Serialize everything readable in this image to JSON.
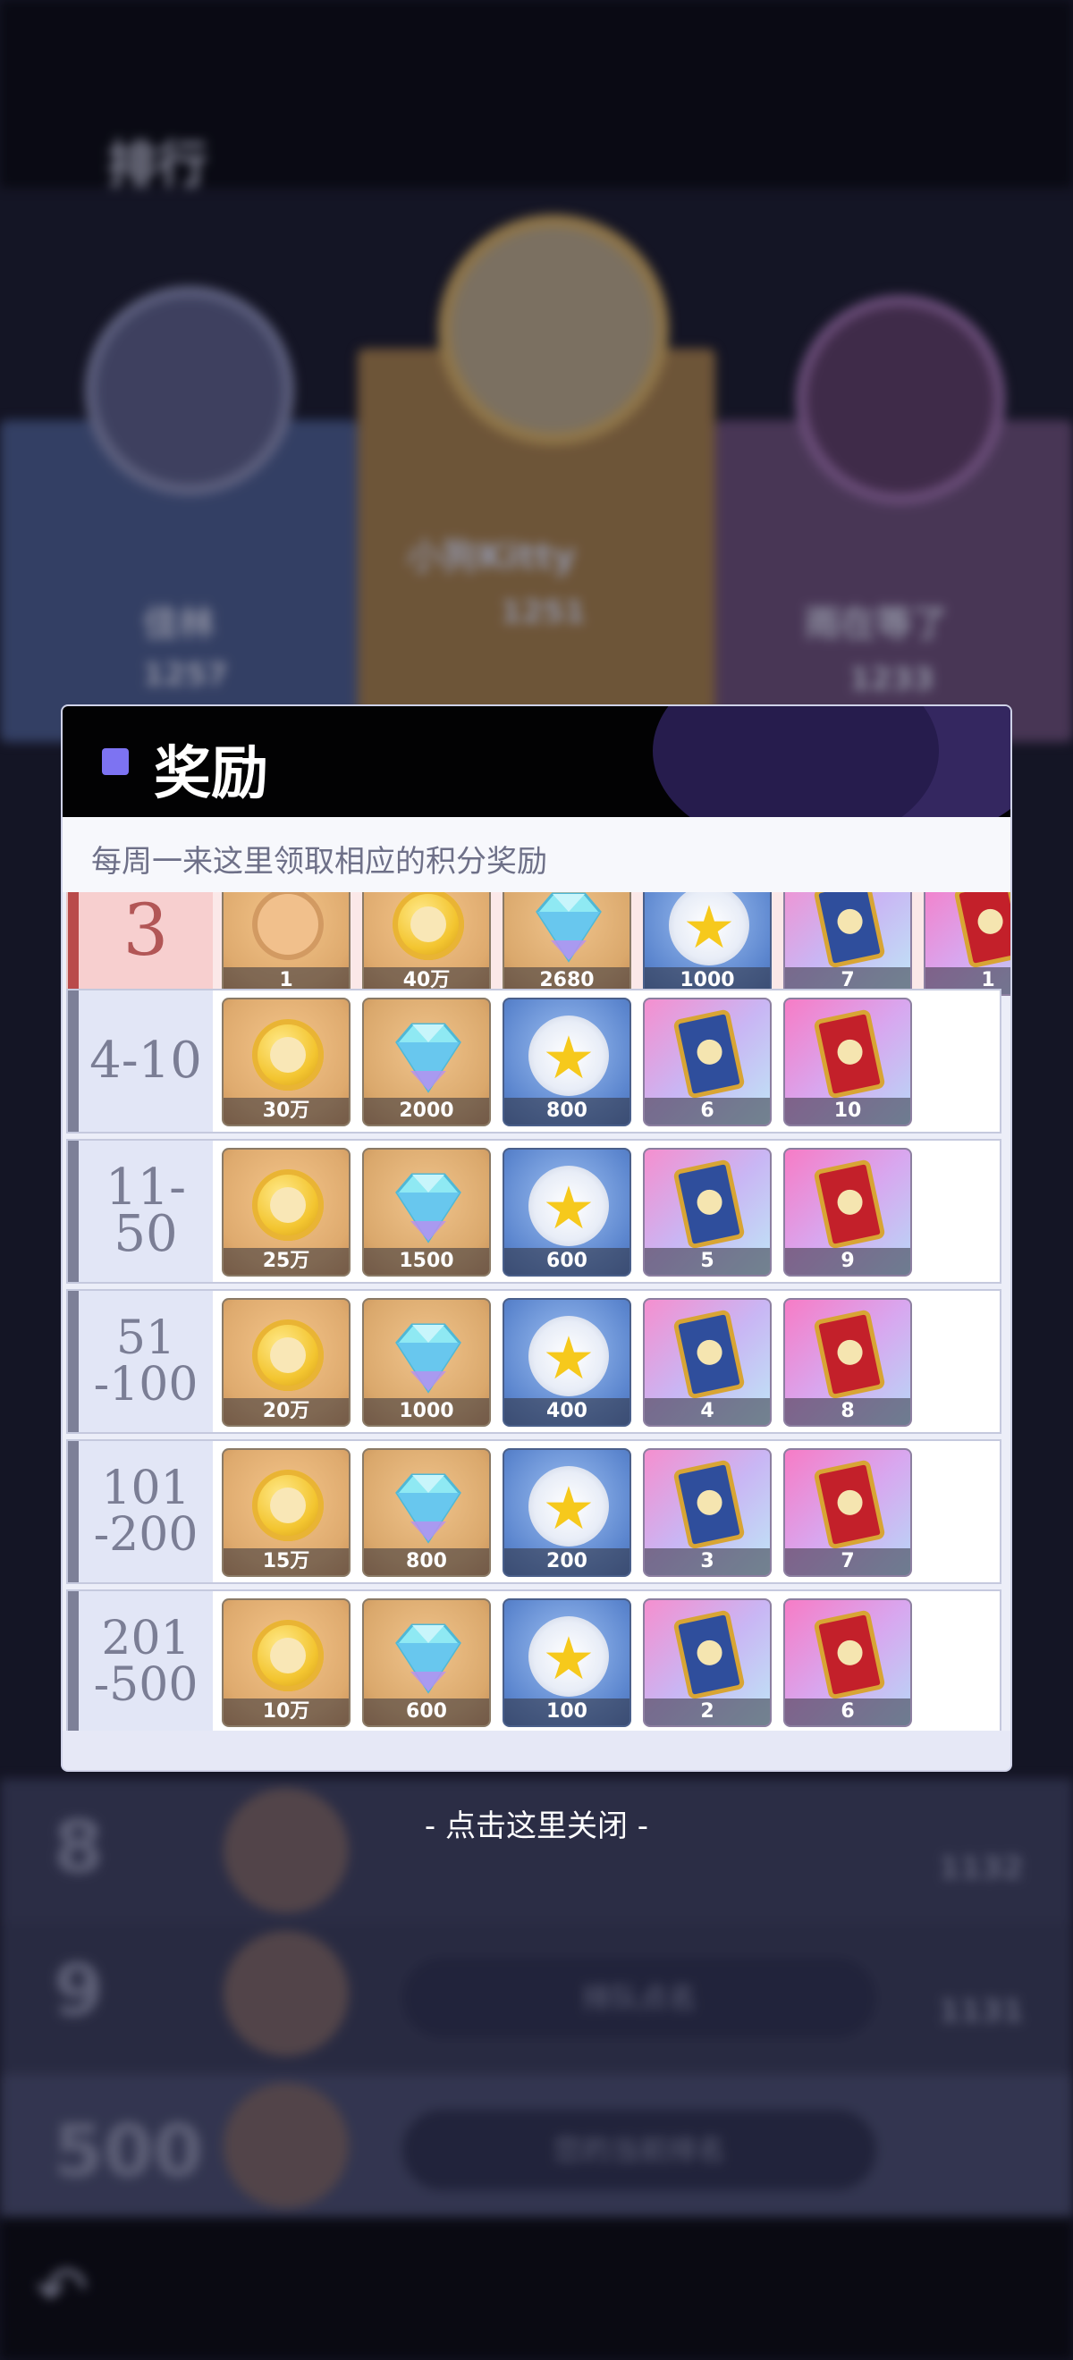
{
  "background": {
    "page_title": "排行",
    "top3": [
      {
        "name": "佳林",
        "score": "1257"
      },
      {
        "name": "小狗Kitty",
        "score": "1251"
      },
      {
        "name": "雨在等了",
        "score": "1233"
      }
    ],
    "rows": [
      {
        "rank": "8",
        "score": "1132"
      },
      {
        "rank": "9",
        "score": "1131",
        "label": "排队点名"
      },
      {
        "rank": "500",
        "label": "您的当前排名"
      }
    ]
  },
  "modal": {
    "title": "奖励",
    "subtitle": "每周一来这里领取相应的积分奖励",
    "close_hint": "- 点击这里关闭 -",
    "tiers": [
      {
        "rank": "3",
        "rewards": [
          {
            "icon": "scroll-icon",
            "qty": "1"
          },
          {
            "icon": "gold-coin-icon",
            "qty": "40万"
          },
          {
            "icon": "diamond-icon",
            "qty": "2680"
          },
          {
            "icon": "star-medal-icon",
            "qty": "1000"
          },
          {
            "icon": "blue-card-icon",
            "qty": "7"
          },
          {
            "icon": "red-card-icon",
            "qty": "1"
          }
        ]
      },
      {
        "rank": "4-10",
        "rewards": [
          {
            "icon": "gold-coin-icon",
            "qty": "30万"
          },
          {
            "icon": "diamond-icon",
            "qty": "2000"
          },
          {
            "icon": "star-medal-icon",
            "qty": "800"
          },
          {
            "icon": "blue-card-icon",
            "qty": "6"
          },
          {
            "icon": "red-card-icon",
            "qty": "10"
          }
        ]
      },
      {
        "rank": "11-50",
        "rewards": [
          {
            "icon": "gold-coin-icon",
            "qty": "25万"
          },
          {
            "icon": "diamond-icon",
            "qty": "1500"
          },
          {
            "icon": "star-medal-icon",
            "qty": "600"
          },
          {
            "icon": "blue-card-icon",
            "qty": "5"
          },
          {
            "icon": "red-card-icon",
            "qty": "9"
          }
        ]
      },
      {
        "rank": "51\n-100",
        "rewards": [
          {
            "icon": "gold-coin-icon",
            "qty": "20万"
          },
          {
            "icon": "diamond-icon",
            "qty": "1000"
          },
          {
            "icon": "star-medal-icon",
            "qty": "400"
          },
          {
            "icon": "blue-card-icon",
            "qty": "4"
          },
          {
            "icon": "red-card-icon",
            "qty": "8"
          }
        ]
      },
      {
        "rank": "101\n-200",
        "rewards": [
          {
            "icon": "gold-coin-icon",
            "qty": "15万"
          },
          {
            "icon": "diamond-icon",
            "qty": "800"
          },
          {
            "icon": "star-medal-icon",
            "qty": "200"
          },
          {
            "icon": "blue-card-icon",
            "qty": "3"
          },
          {
            "icon": "red-card-icon",
            "qty": "7"
          }
        ]
      },
      {
        "rank": "201\n-500",
        "rewards": [
          {
            "icon": "gold-coin-icon",
            "qty": "10万"
          },
          {
            "icon": "diamond-icon",
            "qty": "600"
          },
          {
            "icon": "star-medal-icon",
            "qty": "100"
          },
          {
            "icon": "blue-card-icon",
            "qty": "2"
          },
          {
            "icon": "red-card-icon",
            "qty": "6"
          }
        ]
      }
    ]
  },
  "colors": {
    "header_bg": "#020203",
    "title_square": "#7d73f2",
    "top_tier_accent": "#b94a4a",
    "tier_accent": "#7d8098"
  }
}
